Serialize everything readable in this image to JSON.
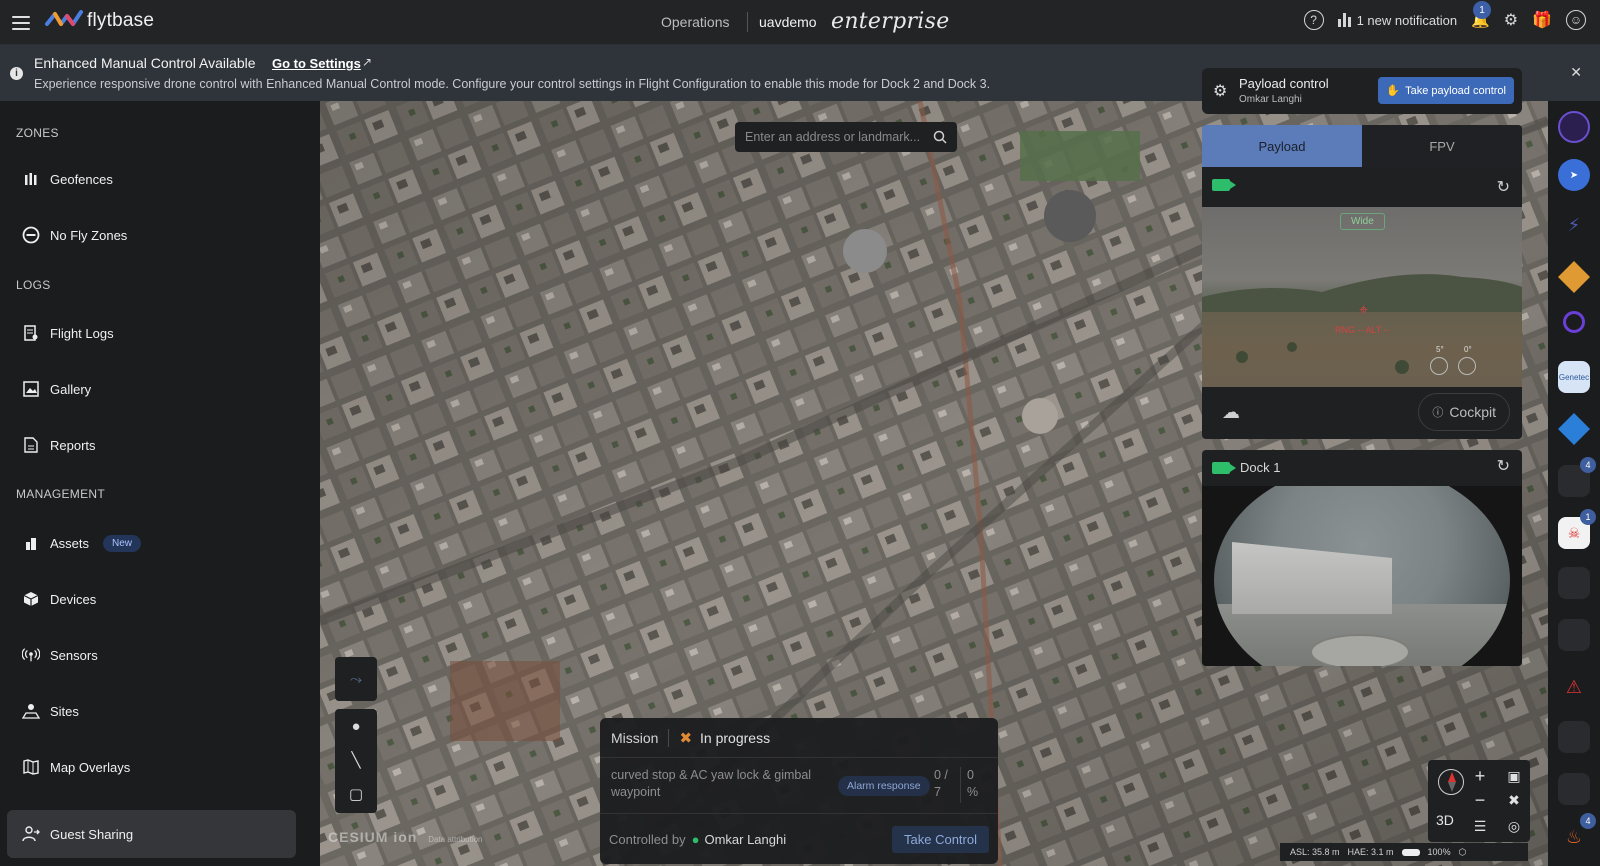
{
  "topbar": {
    "logo_text": "flytbase",
    "operations": "Operations",
    "org": "uavdemo",
    "tier": "enterprise",
    "notification_text": "1 new notification",
    "notification_count": "1"
  },
  "banner": {
    "title": "Enhanced Manual Control Available",
    "link": "Go to Settings",
    "description": "Experience responsive drone control with Enhanced Manual Control mode. Configure your control settings in Flight Configuration to enable this mode for Dock 2 and Dock 3."
  },
  "sidebar": {
    "zones_label": "ZONES",
    "logs_label": "LOGS",
    "management_label": "MANAGEMENT",
    "geofences": "Geofences",
    "no_fly_zones": "No Fly Zones",
    "flight_logs": "Flight Logs",
    "gallery": "Gallery",
    "reports": "Reports",
    "assets": "Assets",
    "assets_badge": "New",
    "devices": "Devices",
    "sensors": "Sensors",
    "sites": "Sites",
    "map_overlays": "Map Overlays",
    "guest_sharing": "Guest Sharing"
  },
  "map": {
    "search_placeholder": "Enter an address or landmark...",
    "cesium": "CESIUM",
    "cesium_ion": "ion",
    "data_attribution": "Data attribution",
    "btn_3d": "3D",
    "asl": "ASL: 35.8 m",
    "hae": "HAE: 3.1 m",
    "battery": "100%"
  },
  "mission": {
    "label": "Mission",
    "status": "In progress",
    "waypoint": "curved stop & AC yaw lock & gimbal waypoint",
    "alarm": "Alarm response",
    "progress_done": "0 /",
    "progress_total": "7",
    "percent_value": "0",
    "percent_sign": "%",
    "controlled_by": "Controlled by",
    "owner": "Omkar Langhi",
    "take_control": "Take Control"
  },
  "payload": {
    "title": "Payload control",
    "owner": "Omkar Langhi",
    "take_button": "Take payload control",
    "tab_payload": "Payload",
    "tab_fpv": "FPV",
    "wide": "Wide",
    "rng": "RNG -- ALT --",
    "angle1": "5°",
    "angle2": "0°",
    "cockpit": "Cockpit"
  },
  "dock": {
    "title": "Dock 1"
  },
  "rail": {
    "badge_a": "4",
    "badge_b": "1",
    "badge_c": "4",
    "genetec": "Genetec"
  },
  "colors": {
    "accent": "#3d6ab8",
    "tab_active": "#5b7cb8",
    "live_green": "#2ebd6b"
  }
}
